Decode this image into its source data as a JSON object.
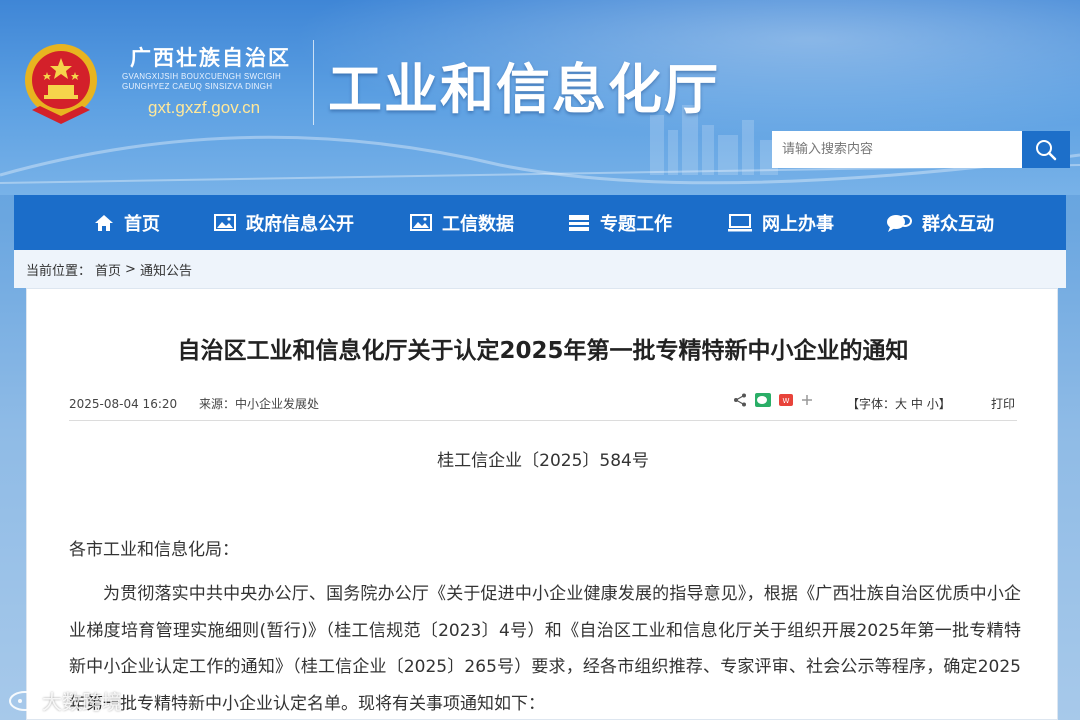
{
  "header": {
    "region_name": "广西壮族自治区",
    "region_zhuang_line1": "GVANGXIJSIH BOUXCUENGH SWCIGIH",
    "region_zhuang_line2": "GUNGHYEZ CAEUQ SINSIZVA DINGH",
    "site_url": "gxt.gxzf.gov.cn",
    "department": "工业和信息化厅",
    "emblem_icon": "national-emblem",
    "search": {
      "placeholder": "请输入搜索内容",
      "icon": "search-icon"
    }
  },
  "nav": {
    "items": [
      {
        "label": "首页",
        "icon": "home-icon"
      },
      {
        "label": "政府信息公开",
        "icon": "image-icon"
      },
      {
        "label": "工信数据",
        "icon": "image-icon"
      },
      {
        "label": "专题工作",
        "icon": "list-icon"
      },
      {
        "label": "网上办事",
        "icon": "monitor-icon"
      },
      {
        "label": "群众互动",
        "icon": "chat-icon"
      }
    ]
  },
  "breadcrumb": {
    "prefix": "当前位置：",
    "items": [
      "首页",
      "通知公告"
    ],
    "separator": ">"
  },
  "article": {
    "title": "自治区工业和信息化厅关于认定2025年第一批专精特新中小企业的通知",
    "datetime": "2025-08-04 16:20",
    "source_label": "来源：",
    "source": "中小企业发展处",
    "share_icons": [
      "share-icon",
      "wechat-icon",
      "weibo-icon",
      "plus-icon"
    ],
    "font_label": "【字体：",
    "font_large": "大",
    "font_medium": "中",
    "font_small": "小",
    "font_close": "】",
    "print": "打印",
    "doc_number": "桂工信企业〔2025〕584号",
    "salutation": "各市工业和信息化局：",
    "paragraph": "为贯彻落实中共中央办公厅、国务院办公厅《关于促进中小企业健康发展的指导意见》，根据《广西壮族自治区优质中小企业梯度培育管理实施细则(暂行)》（桂工信规范〔2023〕4号）和《自治区工业和信息化厅关于组织开展2025年第一批专精特新中小企业认定工作的通知》（桂工信企业〔2025〕265号）要求，经各市组织推荐、专家评审、社会公示等程序，确定2025年第一批专精特新中小企业认定名单。现将有关事项通知如下："
  },
  "watermark": "大数跨境",
  "colors": {
    "nav_bg": "#1b6dc9",
    "search_btn": "#1d6fc9",
    "url": "#ffe89a"
  }
}
